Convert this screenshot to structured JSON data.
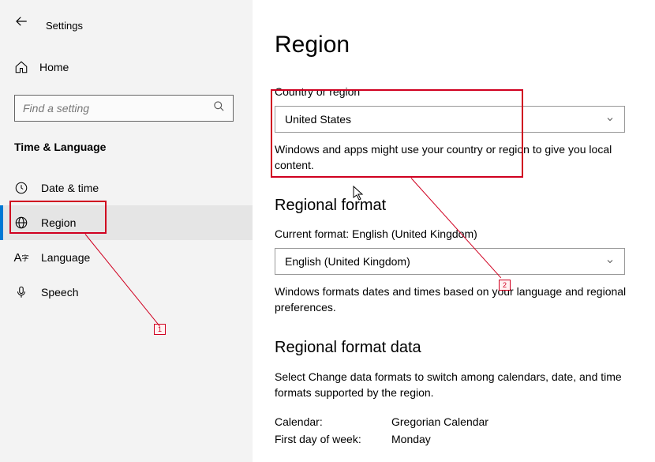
{
  "app_title": "Settings",
  "sidebar": {
    "home_label": "Home",
    "search_placeholder": "Find a setting",
    "category": "Time & Language",
    "items": [
      {
        "label": "Date & time",
        "icon": "clock-icon"
      },
      {
        "label": "Region",
        "icon": "globe-icon",
        "active": true
      },
      {
        "label": "Language",
        "icon": "a-glyph-icon"
      },
      {
        "label": "Speech",
        "icon": "microphone-icon"
      }
    ]
  },
  "main": {
    "title": "Region",
    "country_label": "Country or region",
    "country_value": "United States",
    "country_hint": "Windows and apps might use your country or region to give you local content.",
    "regional_format_title": "Regional format",
    "current_format_label": "Current format: English (United Kingdom)",
    "regional_format_value": "English (United Kingdom)",
    "regional_format_hint": "Windows formats dates and times based on your language and regional preferences.",
    "format_data_title": "Regional format data",
    "format_data_hint": "Select Change data formats to switch among calendars, date, and time formats supported by the region.",
    "format_rows": [
      {
        "label": "Calendar:",
        "value": "Gregorian Calendar"
      },
      {
        "label": "First day of week:",
        "value": "Monday"
      }
    ]
  },
  "annotations": {
    "label1": "1",
    "label2": "2"
  }
}
